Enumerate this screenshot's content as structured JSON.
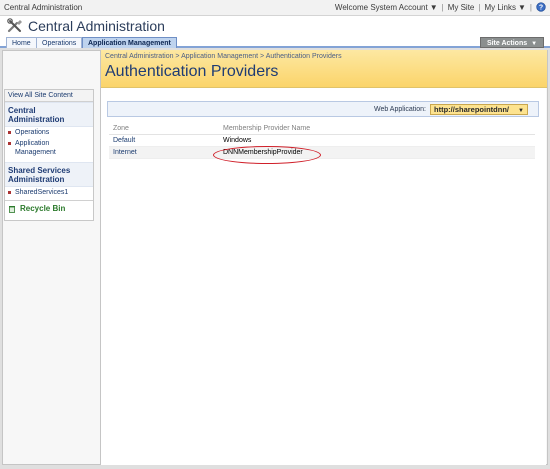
{
  "topbar": {
    "brand": "Central Administration",
    "welcome": "Welcome System Account",
    "my_site": "My Site",
    "my_links": "My Links",
    "help_icon": "help-icon"
  },
  "header": {
    "title": "Central Administration",
    "logo_icon": "tools-icon"
  },
  "tabs": [
    {
      "label": "Home"
    },
    {
      "label": "Operations"
    },
    {
      "label": "Application Management"
    }
  ],
  "site_actions": "Site Actions",
  "leftnav": {
    "view_all": "View All Site Content",
    "sections": [
      {
        "title": "Central Administration",
        "items": [
          "Operations",
          "Application Management"
        ]
      },
      {
        "title": "Shared Services Administration",
        "items": [
          "SharedServices1"
        ]
      }
    ],
    "recycle_bin": "Recycle Bin"
  },
  "page": {
    "breadcrumb": "Central Administration > Application Management > Authentication Providers",
    "title": "Authentication Providers"
  },
  "web_application": {
    "label": "Web Application:",
    "value": "http://sharepointdnn/"
  },
  "table": {
    "headers": [
      "Zone",
      "Membership Provider Name"
    ],
    "rows": [
      {
        "zone": "Default",
        "provider": "Windows"
      },
      {
        "zone": "Internet",
        "provider": "DNNMembershipProvider"
      }
    ]
  },
  "colors": {
    "accent": "#1f3c74",
    "title_bar": "#fbd46a",
    "highlight_circle": "#d0202a"
  }
}
